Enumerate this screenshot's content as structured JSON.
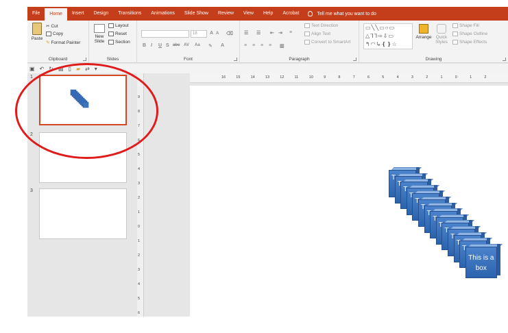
{
  "tabs": [
    "File",
    "Home",
    "Insert",
    "Design",
    "Transitions",
    "Animations",
    "Slide Show",
    "Review",
    "View",
    "Help",
    "Acrobat"
  ],
  "active_tab": "Home",
  "tell_me": "Tell me what you want to do",
  "ribbon": {
    "clipboard": {
      "label": "Clipboard",
      "paste": "Paste",
      "cut": "Cut",
      "copy": "Copy",
      "format_painter": "Format Painter"
    },
    "slides": {
      "label": "Slides",
      "new_slide": "New Slide",
      "layout": "Layout",
      "reset": "Reset",
      "section": "Section"
    },
    "font": {
      "label": "Font",
      "font_name": "",
      "font_size": "18",
      "bold": "B",
      "italic": "I",
      "underline": "U",
      "shadow": "S",
      "strike": "abc",
      "spacing": "AV",
      "case": "Aa"
    },
    "paragraph": {
      "label": "Paragraph",
      "text_direction": "Text Direction",
      "align_text": "Align Text",
      "smartart": "Convert to SmartArt"
    },
    "drawing": {
      "label": "Drawing",
      "arrange": "Arrange",
      "quick_styles": "Quick Styles",
      "shape_fill": "Shape Fill",
      "shape_outline": "Shape Outline",
      "shape_effects": "Shape Effects"
    }
  },
  "slides": [
    {
      "number": "1"
    },
    {
      "number": "2"
    },
    {
      "number": "3"
    }
  ],
  "ruler_h": [
    "16",
    "15",
    "14",
    "13",
    "12",
    "11",
    "10",
    "9",
    "8",
    "7",
    "6",
    "5",
    "4",
    "3",
    "2",
    "1",
    "0",
    "1",
    "2"
  ],
  "ruler_v": [
    "9",
    "8",
    "7",
    "6",
    "5",
    "4",
    "3",
    "2",
    "1",
    "0",
    "1",
    "2",
    "3",
    "4",
    "5",
    "6"
  ],
  "boxes": {
    "truncated_label": "T",
    "front_label": "This is a box",
    "count": 14,
    "fill": "#3d74c0"
  },
  "accent_color": "#c43e1c",
  "annotation_color": "#e01b1b"
}
